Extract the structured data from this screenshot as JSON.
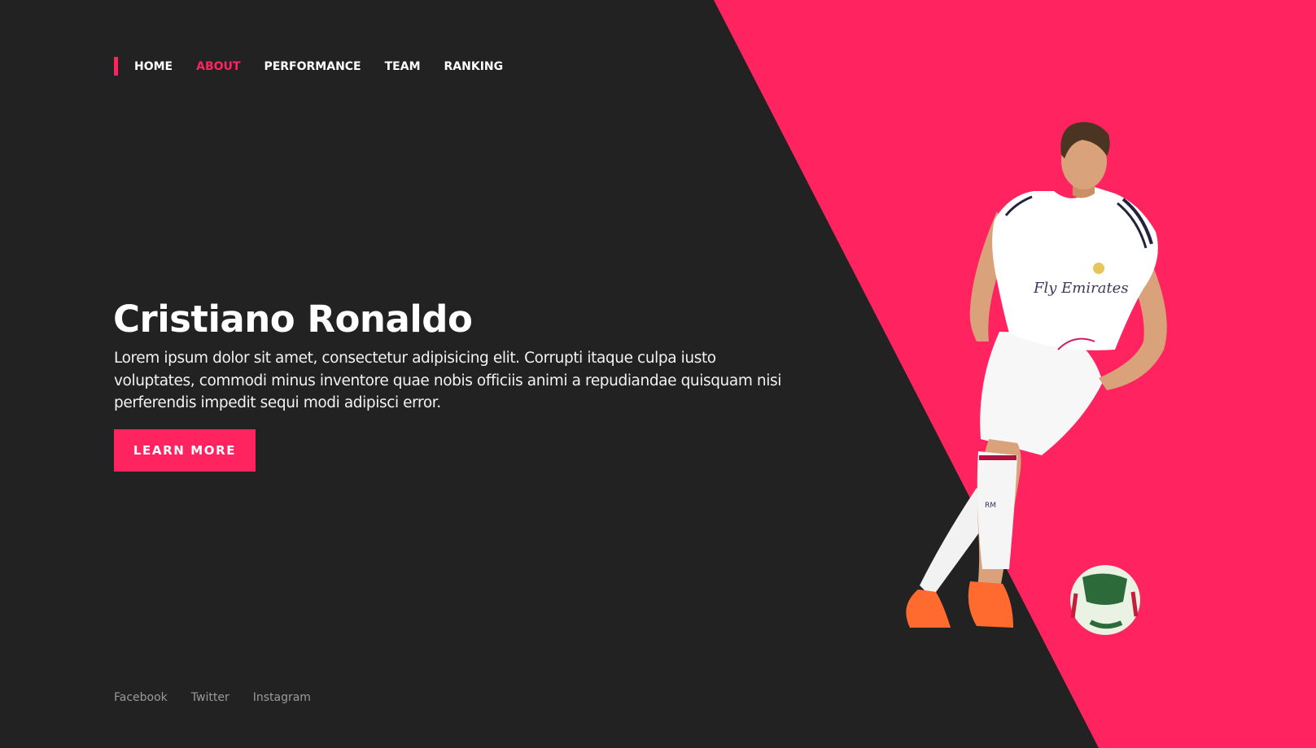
{
  "nav": {
    "items": [
      {
        "label": "HOME",
        "active": false
      },
      {
        "label": "ABOUT",
        "active": true
      },
      {
        "label": "PERFORMANCE",
        "active": false
      },
      {
        "label": "TEAM",
        "active": false
      },
      {
        "label": "RANKING",
        "active": false
      }
    ]
  },
  "hero": {
    "title": "Cristiano Ronaldo",
    "description": "Lorem ipsum dolor sit amet, consectetur adipisicing elit. Corrupti itaque culpa iusto voluptates, commodi minus inventore quae nobis officiis animi a repudiandae quisquam nisi perferendis impedit sequi modi adipisci error.",
    "cta_label": "LEARN MORE"
  },
  "social": {
    "links": [
      "Facebook",
      "Twitter",
      "Instagram"
    ]
  },
  "image": {
    "jersey_text": "Fly Emirates",
    "sock_text": "RM"
  },
  "colors": {
    "accent": "#FF2360",
    "background": "#222222",
    "text": "#ffffff",
    "muted": "#9a9a9a"
  }
}
